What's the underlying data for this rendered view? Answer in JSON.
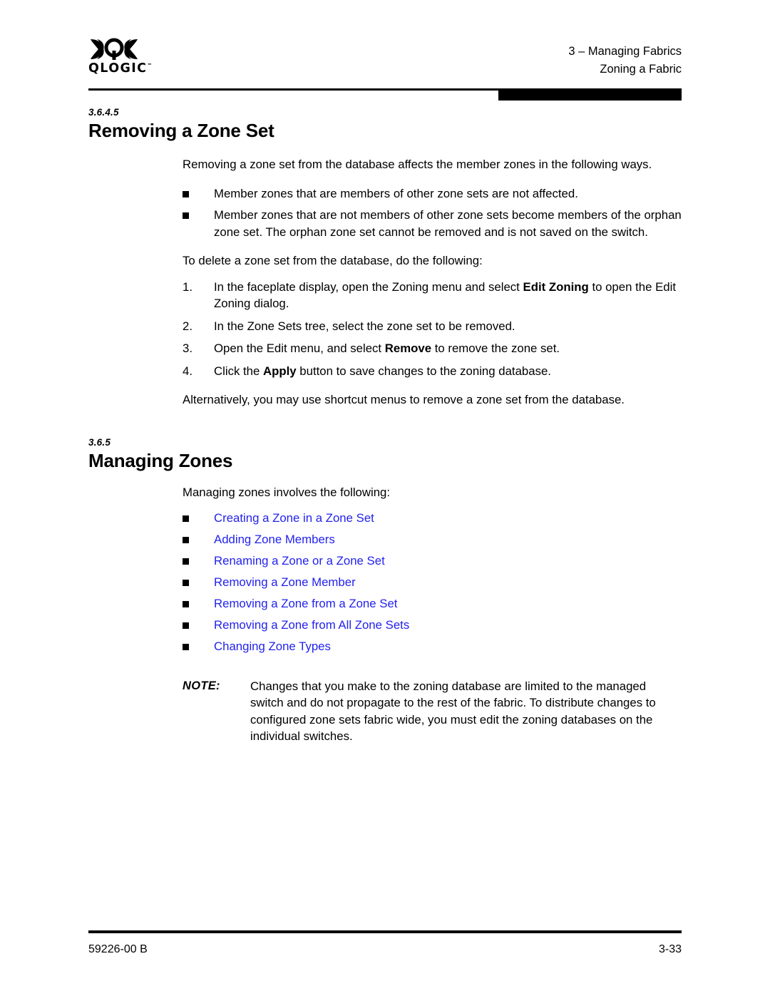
{
  "header": {
    "logo_text": "QLOGIC",
    "logo_tm": "™",
    "logo_icon": "qlogic-mark-icon",
    "chapter": "3 – Managing Fabrics",
    "section": "Zoning a Fabric"
  },
  "section_a": {
    "number": "3.6.4.5",
    "title": "Removing a Zone Set",
    "intro": "Removing a zone set from the database affects the member zones in the following ways.",
    "bullets": [
      "Member zones that are members of other zone sets are not affected.",
      "Member zones that are not members of other zone sets become members of the orphan zone set. The orphan zone set cannot be removed and is not saved on the switch."
    ],
    "steps_lead": "To delete a zone set from the database, do the following:",
    "steps": [
      {
        "number": "1.",
        "text_before": "In the faceplate display, open the Zoning menu and select ",
        "bold": "Edit Zoning",
        "text_after": " to open the Edit Zoning dialog."
      },
      {
        "number": "2.",
        "text_before": "In the Zone Sets tree, select the zone set to be removed.",
        "bold": "",
        "text_after": ""
      },
      {
        "number": "3.",
        "text_before": "Open the Edit menu, and select ",
        "bold": "Remove",
        "text_after": " to remove the zone set."
      },
      {
        "number": "4.",
        "text_before": "Click the ",
        "bold": "Apply",
        "text_after": " button to save changes to the zoning database."
      }
    ],
    "closing": "Alternatively, you may use shortcut menus to remove a zone set from the database."
  },
  "section_b": {
    "number": "3.6.5",
    "title": "Managing Zones",
    "intro": "Managing zones involves the following:",
    "links": [
      "Creating a Zone in a Zone Set",
      "Adding Zone Members",
      "Renaming a Zone or a Zone Set",
      "Removing a Zone Member",
      "Removing a Zone from a Zone Set",
      "Removing a Zone from All Zone Sets",
      "Changing Zone Types"
    ],
    "note_label": "NOTE:",
    "note_text": "Changes that you make to the zoning database are limited to the managed switch and do not propagate to the rest of the fabric. To distribute changes to configured zone sets fabric wide, you must edit the zoning databases on the individual switches."
  },
  "footer": {
    "doc_number": "59226-00 B",
    "page_number": "3-33"
  },
  "colors": {
    "link": "#2222ee",
    "text": "#000000",
    "background": "#ffffff"
  }
}
